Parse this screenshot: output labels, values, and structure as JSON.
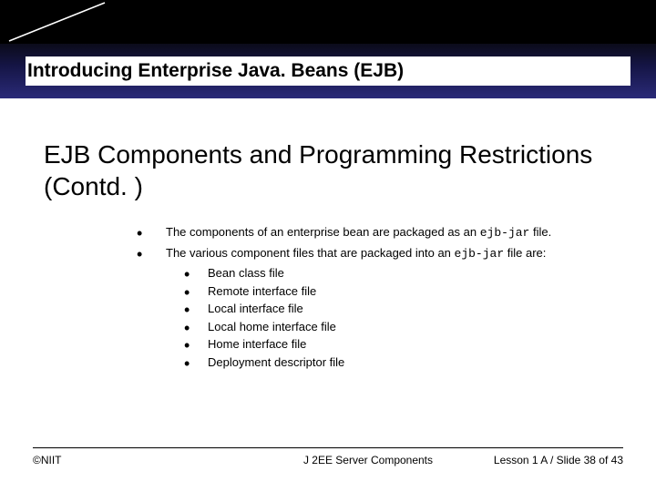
{
  "header": {
    "slide_title": "Introducing Enterprise Java. Beans (EJB)"
  },
  "content": {
    "title": "EJB Components and Programming Restrictions (Contd. )",
    "bullets": [
      {
        "pre": "The components of an enterprise bean are packaged as an ",
        "code": "ejb-jar",
        "post": " file."
      },
      {
        "pre": "The various component files that are packaged into an ",
        "code": "ejb-jar",
        "post": " file are:",
        "sub": [
          "Bean class file",
          "Remote interface file",
          "Local interface file",
          "Local home interface file",
          "Home interface file",
          "Deployment descriptor file"
        ]
      }
    ]
  },
  "footer": {
    "left": "©NIIT",
    "center": "J 2EE Server Components",
    "right": "Lesson 1 A / Slide 38 of 43"
  }
}
